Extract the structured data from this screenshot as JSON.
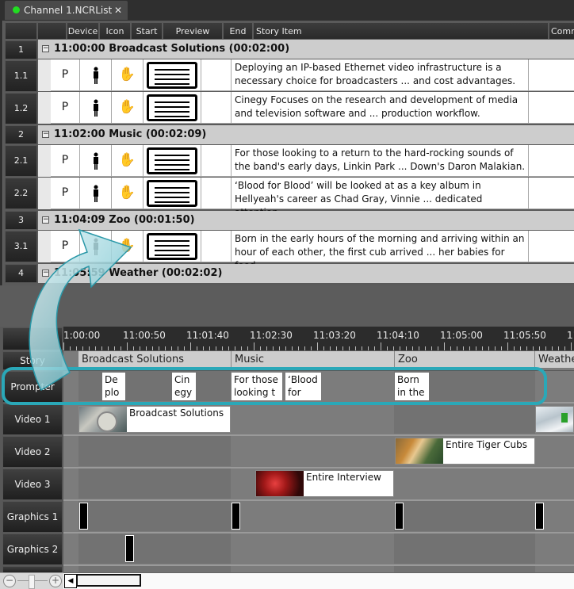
{
  "tab": {
    "title": "Channel  1.NCRList",
    "status_color": "#22dd22",
    "close_glyph": "✕"
  },
  "grid": {
    "columns": [
      "Device",
      "Icon",
      "Start",
      "Preview",
      "End",
      "Story Item",
      "Comm"
    ],
    "groups": [
      {
        "num": "1",
        "title": "11:00:00  Broadcast Solutions (00:02:00)",
        "items": [
          {
            "num": "1.1",
            "device": "P",
            "story": "Deploying an IP-based Ethernet video infrastructure is a necessary choice for broadcasters ... and cost advantages."
          },
          {
            "num": "1.2",
            "device": "P",
            "story": "Cinegy Focuses on the research and development of media and television software and ... production workflow."
          }
        ]
      },
      {
        "num": "2",
        "title": "11:02:00  Music (00:02:09)",
        "items": [
          {
            "num": "2.1",
            "device": "P",
            "story": "For those looking to a return to the hard-rocking sounds of the band's early days, Linkin Park ... Down's Daron Malakian."
          },
          {
            "num": "2.2",
            "device": "P",
            "story": "‘Blood for Blood’ will be looked at as a key album in Hellyeah's career as Chad Gray, Vinnie ... dedicated attention."
          }
        ]
      },
      {
        "num": "3",
        "title": "11:04:09  Zoo (00:01:50)",
        "items": [
          {
            "num": "3.1",
            "device": "P",
            "story": "Born in the early hours of the morning and arriving within an hour of each other, the first cub arrived ... her babies for food."
          }
        ]
      },
      {
        "num": "4",
        "title": "11:05:59  Weather (00:02:02)",
        "items": []
      }
    ]
  },
  "timeline": {
    "ruler": [
      "1:00:00",
      "11:00:50",
      "11:01:40",
      "11:02:30",
      "11:03:20",
      "11:04:10",
      "11:05:00",
      "11:05:50",
      "11"
    ],
    "tracks": [
      "Story",
      "Prompter",
      "Video 1",
      "Video 2",
      "Video 3",
      "Graphics 1",
      "Graphics 2"
    ],
    "stories": [
      "Broadcast Solutions",
      "Music",
      "Zoo",
      "Weathe"
    ],
    "prompter_cards": [
      "De\nplo",
      "Cin\negy",
      "For those\nlooking t",
      "‘Blood\nfor Blo",
      "Born\nin the"
    ],
    "clips": {
      "video1": [
        "Broadcast Solutions",
        ""
      ],
      "video2": [
        "Entire Tiger Cubs"
      ],
      "video3": [
        "Entire Interview"
      ]
    },
    "highlight_color": "#2aa8b8"
  },
  "zoom": {
    "minus": "−",
    "plus": "+"
  }
}
